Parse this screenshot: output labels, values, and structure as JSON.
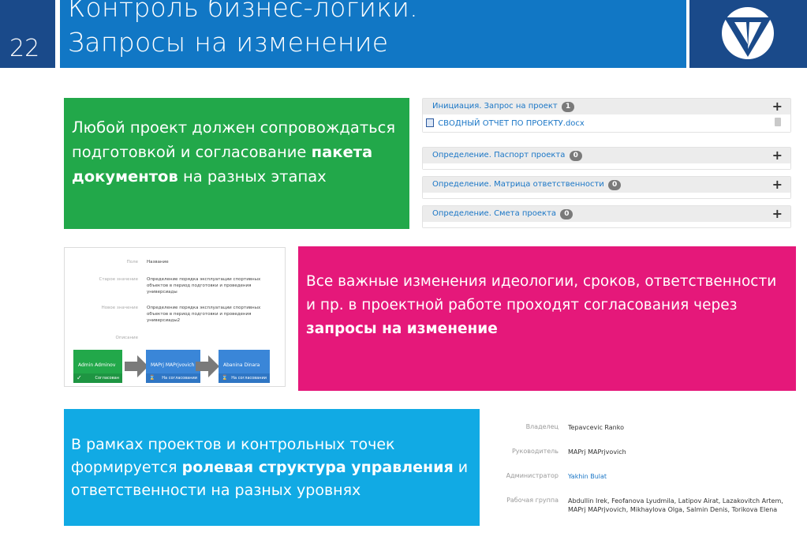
{
  "header": {
    "slide_number": "22",
    "title_line1": "Контроль бизнес-логики.",
    "title_line2": "Запросы на изменение",
    "logo_icon": "company-logo-icon"
  },
  "colors": {
    "header_blue": "#1177c5",
    "header_dark": "#1a4a8a",
    "green": "#22a84a",
    "pink": "#e5187a",
    "cyan": "#11aae4",
    "link_blue": "#1a76c6"
  },
  "green_block": {
    "text_before": "Любой проект должен сопровождаться подготовкой и согласование ",
    "text_bold": "пакета документов",
    "text_after": " на разных этапах"
  },
  "documents": {
    "sections": [
      {
        "title": "Инициация. Запрос на проект",
        "count": "1",
        "files": [
          "СВОДНЫЙ ОТЧЕТ ПО ПРОЕКТУ.docx"
        ]
      },
      {
        "title": "Определение. Паспорт проекта",
        "count": "0",
        "files": []
      },
      {
        "title": "Определение. Матрица ответственности",
        "count": "0",
        "files": []
      },
      {
        "title": "Определение. Смета проекта",
        "count": "0",
        "files": []
      }
    ],
    "add_symbol": "+"
  },
  "change_request": {
    "fields": [
      {
        "label": "Поле",
        "value": "Название"
      },
      {
        "label": "Старое значение",
        "value": "Определение порядка эксплуатации спортивных объектов в период подготовки и проведения универсиады"
      },
      {
        "label": "Новое значение",
        "value": "Определение порядка эксплуатации спортивных объектов в период подготовки и проведения универсиады2"
      },
      {
        "label": "Описание",
        "value": ""
      }
    ],
    "workflow": [
      {
        "name": "Admin Adminov",
        "status": "Согласован",
        "color": "#22a84a"
      },
      {
        "name": "MAPrj MAPrjvovich",
        "status": "На согласовании",
        "color": "#3a86d8"
      },
      {
        "name": "Abanina Dinara",
        "status": "На согласовании",
        "color": "#3a86d8"
      }
    ]
  },
  "pink_block": {
    "text_before": "Все важные изменения идеологии, сроков, ответственности и пр. в проектной работе проходят согласования через",
    "text_bold": "запросы на изменение"
  },
  "cyan_block": {
    "text_before": "В рамках проектов и контрольных точек формируется ",
    "text_bold": "ролевая структура управления",
    "text_after": " и ответственности на разных уровнях"
  },
  "roles": [
    {
      "label": "Владелец",
      "value": "Tepavcevic Ranko",
      "link": false
    },
    {
      "label": "Руководитель",
      "value": "MAPrj MAPrjvovich",
      "link": false
    },
    {
      "label": "Администратор",
      "value": "Yakhin Bulat",
      "link": true
    },
    {
      "label": "Рабочая группа",
      "value": "Abdullin Irek, Feofanova Lyudmila, Latipov Airat, Lazakovitch Artem, MAPrj MAPrjvovich, Mikhaylova Olga, Salmin Denis, Torikova Elena",
      "link": false
    }
  ]
}
